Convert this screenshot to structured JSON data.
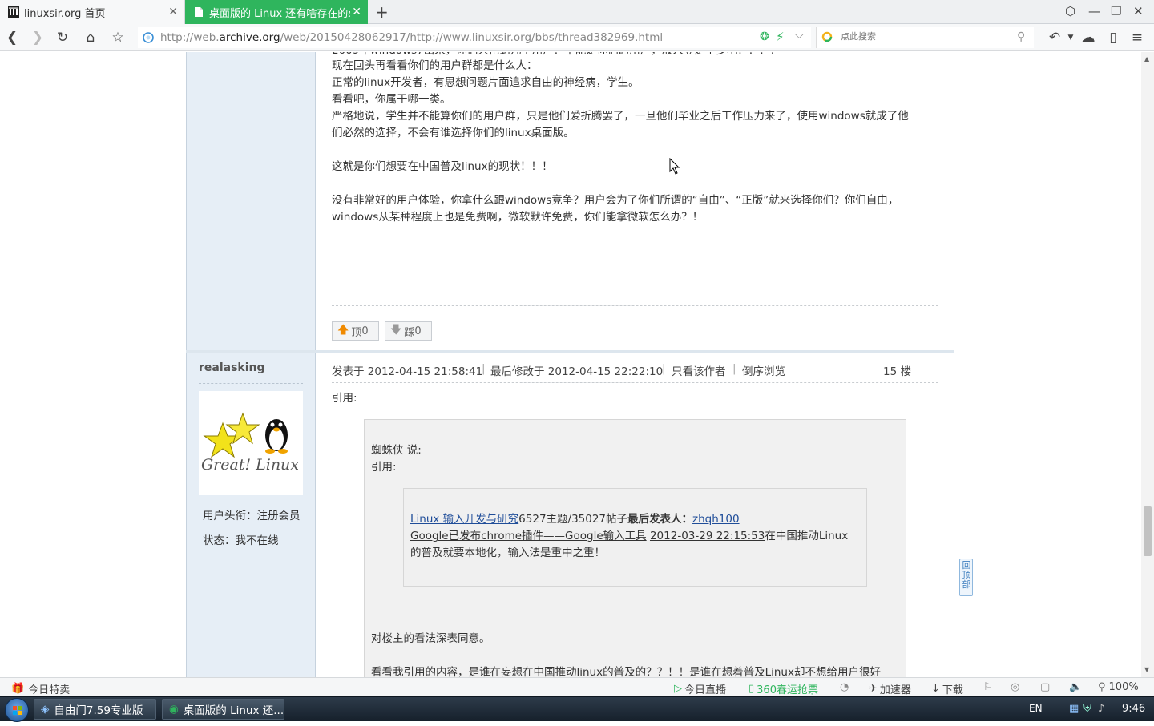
{
  "tabs": [
    {
      "title": "linuxsir.org 首页",
      "active": false
    },
    {
      "title": "桌面版的 Linux 还有啥存在的必要",
      "active": true
    }
  ],
  "nav": {
    "url_prefix": "http://web.",
    "url_domain": "archive.org",
    "url_rest": "/web/20150428062917/http://www.linuxsir.org/bbs/thread382969.html",
    "search_placeholder": "点此搜索"
  },
  "post1": {
    "lines": [
      "现在回头再看看你们的用户群都是什么人：",
      "正常的linux开发者，有思想问题片面追求自由的神经病，学生。",
      "看看吧，你属于哪一类。",
      "严格地说，学生并不能算你们的用户群，只是他们爱折腾罢了，一旦他们毕业之后工作压力来了，使用windows就成了他",
      "们必然的选择，不会有谁选择你们的linux桌面版。",
      "",
      "这就是你们想要在中国普及linux的现状！！！",
      "",
      "没有非常好的用户体验，你拿什么跟windows竞争？用户会为了你们所谓的“自由”、“正版”就来选择你们？你们自由，",
      "windows从某种程度上也是免费啊，微软默许免费，你们能拿微软怎么办？！"
    ],
    "vote_up_label": "顶",
    "vote_up_count": "0",
    "vote_down_label": "踩",
    "vote_down_count": "0"
  },
  "post2": {
    "author": "realasking",
    "avatar_text": "Great! Linux",
    "rank_label": "用户头衔：注册会员",
    "status_label": "状态：我不在线",
    "posted": "发表于 2012-04-15 21:58:41",
    "modified": "最后修改于 2012-04-15 22:22:10",
    "only_author": "只看该作者",
    "reverse": "倒序浏览",
    "floor": "15 楼",
    "quote_label": "引用:",
    "inner_author": "蜘蛛侠 说:",
    "inner_quote_label": "引用:",
    "inner_quote": {
      "forum_link": "Linux 输入开发与研究",
      "stats": "6527主题/35027帖子",
      "last_poster_label": "最后发表人：",
      "last_poster": "zhqh100",
      "thread_link": "Google已发布chrome插件——Google输入工具",
      "date_link": "2012-03-29 22:15:53",
      "tail": "在中国推动Linux",
      "line3": "的普及就要本地化，输入法是重中之重！"
    },
    "reply_line1": "对楼主的看法深表同意。",
    "reply_line2": "看看我引用的内容，是谁在妄想在中国推动linux的普及的？？！！是谁在想着普及Linux却不想给用户很好"
  },
  "back_to_top": "回顶部",
  "statusbar": {
    "left": "今日特卖",
    "live": "今日直播",
    "tickets": "360春运抢票",
    "accelerator": "加速器",
    "download": "下载",
    "zoom": "100%"
  },
  "taskbar": {
    "item1": "自由门7.59专业版",
    "item2": "桌面版的 Linux 还...",
    "lang": "EN",
    "time": "9:46"
  },
  "colors": {
    "active_tab": "#2fb55d",
    "link": "#1f4d99",
    "sidebar_bg": "#e6eef6"
  }
}
